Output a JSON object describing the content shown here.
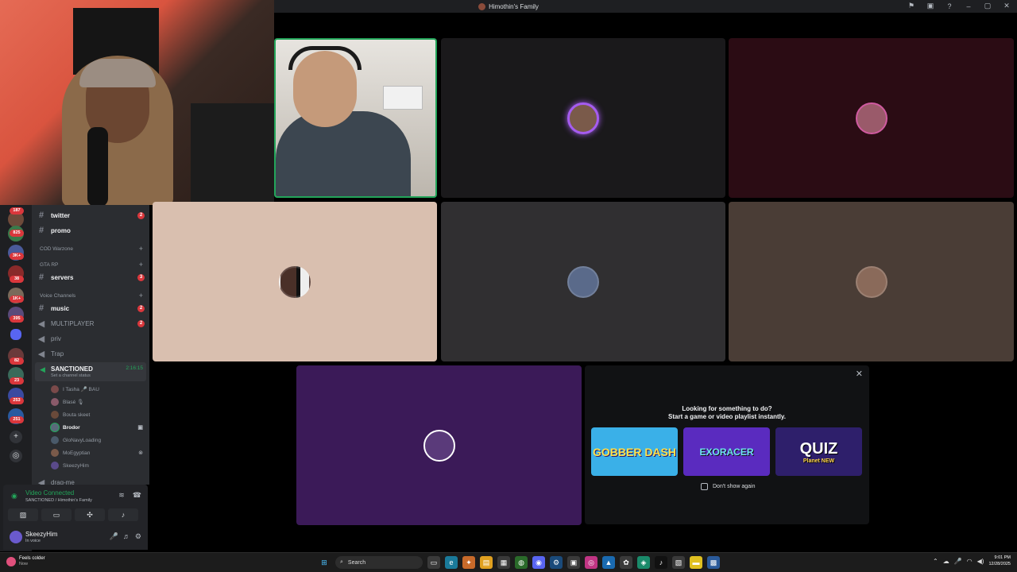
{
  "window": {
    "title": "Himothin's Family",
    "controls": [
      "⚑",
      "▣",
      "?",
      "–",
      "▢",
      "✕"
    ]
  },
  "rail": {
    "badges": [
      "187",
      "825",
      "3K+",
      "38",
      "1K+",
      "395",
      "82",
      "23",
      "253",
      "251"
    ]
  },
  "sidebar": {
    "channels_top": [
      {
        "label": "twitter",
        "count": "2"
      },
      {
        "label": "promo",
        "count": ""
      }
    ],
    "category_cod": "COD Warzone",
    "category_gta": "GTA RP",
    "channel_servers": {
      "label": "servers",
      "count": "3"
    },
    "category_voice": "Voice Channels",
    "channel_music": {
      "label": "music",
      "count": "2"
    },
    "voice_channels": [
      {
        "label": "MULTIPLAYER",
        "count": "2"
      },
      {
        "label": "priv",
        "count": ""
      },
      {
        "label": "Trap",
        "count": ""
      }
    ],
    "active_voice": {
      "name": "SANCTIONED",
      "timer": "2:16:15",
      "status_placeholder": "Set a channel status"
    },
    "members": [
      {
        "name": "I Tasha 🎤 BAU",
        "tail": ""
      },
      {
        "name": "Blasé 🎙",
        "tail": ""
      },
      {
        "name": "Bouta skeet",
        "tail": ""
      },
      {
        "name": "Brodor",
        "tail": "▣"
      },
      {
        "name": "GloNavyLoading",
        "tail": ""
      },
      {
        "name": "MoEgyptian",
        "tail": "⊗"
      },
      {
        "name": "SkeezyHim",
        "tail": ""
      }
    ],
    "next_channel": "drag-me"
  },
  "voice_panel": {
    "status": "Video Connected",
    "location": "SANCTIONED / Himothin's Family"
  },
  "user_panel": {
    "username": "SkeezyHim",
    "status": "In voice"
  },
  "activity": {
    "heading": "Looking for something to do?",
    "subheading": "Start a game or video playlist instantly.",
    "games": [
      {
        "title": "GOBBER DASH",
        "sub": ""
      },
      {
        "title": "EXORACER",
        "sub": ""
      },
      {
        "title": "QUIZ",
        "sub": "Planet NEW"
      }
    ],
    "dont_show": "Don't show again"
  },
  "taskbar": {
    "weather_title": "Feels colder",
    "weather_sub": "Now",
    "search_placeholder": "Search",
    "time": "9:01 PM",
    "date": "12/28/2025"
  },
  "colors": {
    "discord_green": "#23a55a",
    "badge_red": "#da373c",
    "sidebar_bg": "#2b2d31",
    "tile_dark": "#1a191b",
    "tile_maroon": "#2b0c14",
    "tile_beige": "#d9bfaf",
    "tile_gray": "#302f31",
    "tile_brown": "#4a3d36",
    "tile_purple": "#3b1a58"
  }
}
